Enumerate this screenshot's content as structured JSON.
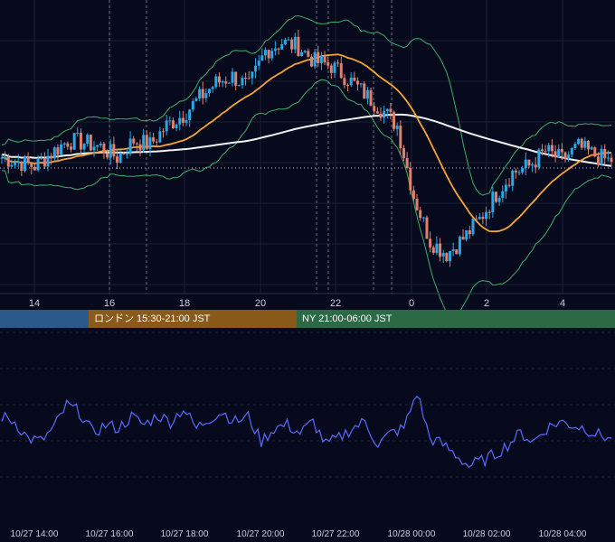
{
  "chart_data": [
    {
      "type": "candlestick",
      "panel": "price",
      "x_ticks": [
        "14",
        "16",
        "18",
        "20",
        "22",
        "0",
        "2",
        "4"
      ],
      "indicators": [
        "bollinger-bands",
        "moving-average-fast",
        "moving-average-slow"
      ],
      "grid": true,
      "colors": {
        "up": "#2aa7e6",
        "down": "#e0806f",
        "bollinger": "#3fae6a",
        "ma_fast": "#f5a533",
        "ma_slow": "#f2f2f2",
        "background": "#070a1c"
      },
      "candles_close_trace": [
        5.05,
        4.95,
        4.85,
        5.15,
        5.45,
        5.4,
        5.3,
        5.05,
        5.45,
        5.35,
        5.8,
        6.05,
        6.45,
        6.8,
        6.95,
        6.7,
        7.55,
        7.75,
        7.65,
        7.3,
        7.2,
        6.9,
        6.55,
        6.2,
        5.8,
        4.15,
        3.1,
        2.8,
        3.15,
        3.6,
        4.2,
        4.7,
        4.85,
        5.2,
        5.0,
        5.3,
        5.1,
        4.95
      ]
    },
    {
      "type": "line",
      "panel": "oscillator",
      "x_labels": [
        "10/27 14:00",
        "10/27 16:00",
        "10/27 18:00",
        "10/27 20:00",
        "10/27 22:00",
        "10/28 00:00",
        "10/28 02:00",
        "10/28 04:00"
      ],
      "series": [
        {
          "values": [
            65,
            62,
            52,
            50,
            58,
            72,
            68,
            55,
            60,
            58,
            65,
            60,
            66,
            62,
            70,
            58,
            64,
            68,
            62,
            65,
            50,
            58,
            60,
            55,
            62,
            48,
            52,
            58,
            62,
            48,
            55,
            58,
            80,
            52,
            48,
            42,
            35,
            38,
            42,
            48,
            55,
            50,
            58,
            62,
            60,
            58,
            54,
            52
          ]
        }
      ],
      "color": "#5a6aff",
      "grid": true
    }
  ],
  "sessions": {
    "asia": "",
    "london": "ロンドン 15:30-21:00 JST",
    "ny": "NY 21:00-06:00 JST"
  }
}
